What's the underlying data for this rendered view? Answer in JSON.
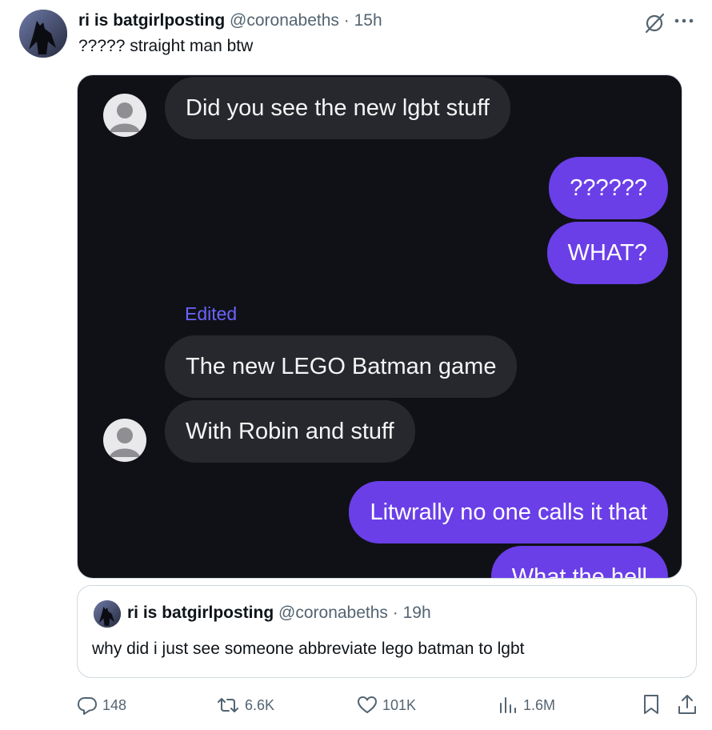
{
  "tweet": {
    "display_name": "ri is batgirlposting",
    "handle": "@coronabeths",
    "separator": "·",
    "time": "15h",
    "text": "????? straight man btw"
  },
  "chat": {
    "messages": [
      {
        "side": "in",
        "text": "Did you see the new lgbt stuff"
      },
      {
        "side": "out",
        "text": "??????"
      },
      {
        "side": "out",
        "text": "WHAT?"
      },
      {
        "side": "in",
        "text": "The new LEGO Batman game"
      },
      {
        "side": "in",
        "text": "With Robin and stuff"
      },
      {
        "side": "out",
        "text": "Litwrally no one calls it that"
      },
      {
        "side": "out",
        "text": "What the hell"
      }
    ],
    "edited_label": "Edited"
  },
  "quote": {
    "display_name": "ri is batgirlposting",
    "handle": "@coronabeths",
    "separator": "·",
    "time": "19h",
    "text": "why did i just see someone abbreviate lego batman to lgbt"
  },
  "actions": {
    "replies": "148",
    "reposts": "6.6K",
    "likes": "101K",
    "views": "1.6M"
  },
  "icons": {
    "reply": "reply-icon",
    "repost": "repost-icon",
    "like": "heart-icon",
    "views": "views-icon",
    "bookmark": "bookmark-icon",
    "share": "share-icon",
    "grok": "grok-icon",
    "more": "more-icon"
  },
  "colors": {
    "outgoing_bubble": "#6a3fe8",
    "incoming_bubble": "#27282d",
    "chat_background": "#101116",
    "edited_label": "#6b63ff",
    "secondary_text": "#536471"
  }
}
